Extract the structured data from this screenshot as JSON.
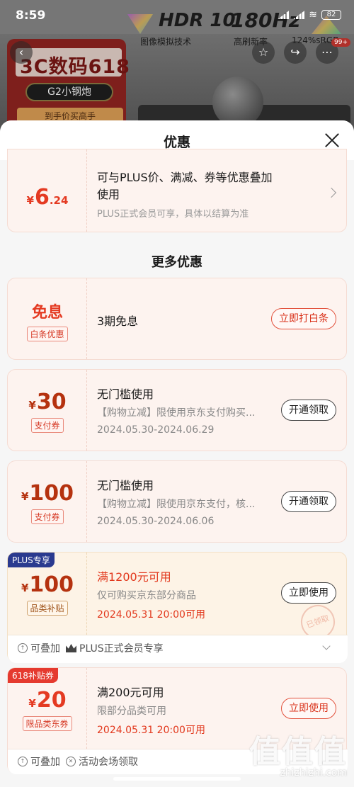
{
  "status_bar": {
    "time": "8:59",
    "battery": "82"
  },
  "background_page": {
    "promo_title": "3C数码618",
    "promo_pill": "G2小钢炮",
    "promo_sub": "到手价买高手",
    "hdr_text": "HDR 10",
    "hdr_caption": "图像模拟技术",
    "hz_text": "180Hz",
    "hz_caption": "高刷新率",
    "gamut_caption": "124%sRGB",
    "notif_badge": "99+"
  },
  "sheet": {
    "title": "优惠",
    "top_coupon": {
      "currency": "¥",
      "amount_int": "6",
      "amount_dec": ".24",
      "title_line1": "可与PLUS价、满减、券等优惠叠加",
      "title_line2": "使用",
      "desc": "PLUS正式会员可享，具体以结算为准"
    },
    "more_title": "更多优惠",
    "baitiao": {
      "big_text": "免息",
      "tag": "白条优惠",
      "title": "3期免息",
      "button": "立即打白条"
    },
    "coupon_30": {
      "currency": "¥",
      "amount": "30",
      "tag": "支付券",
      "title": "无门槛使用",
      "desc": "【购物立减】限使用京东支付购买...",
      "date": "2024.05.30-2024.06.29",
      "button": "开通领取"
    },
    "coupon_100_pay": {
      "currency": "¥",
      "amount": "100",
      "tag": "支付券",
      "title": "无门槛使用",
      "desc": "【购物立减】限使用京东支付，核...",
      "date": "2024.05.30-2024.06.06",
      "button": "开通领取"
    },
    "coupon_plus": {
      "corner": "PLUS专享",
      "currency": "¥",
      "amount": "100",
      "tag": "品类补贴",
      "title": "满1200元可用",
      "desc": "仅可购买京东部分商品",
      "date": "2024.05.31 20:00可用",
      "button": "立即使用",
      "stamp": "已领取",
      "meta_stack": "可叠加",
      "meta_plus": "PLUS正式会员专享"
    },
    "coupon_618": {
      "corner": "618补贴券",
      "currency": "¥",
      "amount": "20",
      "tag": "限品类东券",
      "title": "满200元可用",
      "desc": "限部分品类可用",
      "date": "2024.05.31 20:00可用",
      "button": "立即使用",
      "meta_stack": "可叠加",
      "meta_event": "活动会场领取"
    }
  },
  "watermark": {
    "chars": "值值值",
    "url": "zhizhizhi.com"
  },
  "colors": {
    "accent_red": "#e2381d",
    "plus_blue": "#2a3a8f",
    "sheet_bg": "#f6f6f6"
  }
}
